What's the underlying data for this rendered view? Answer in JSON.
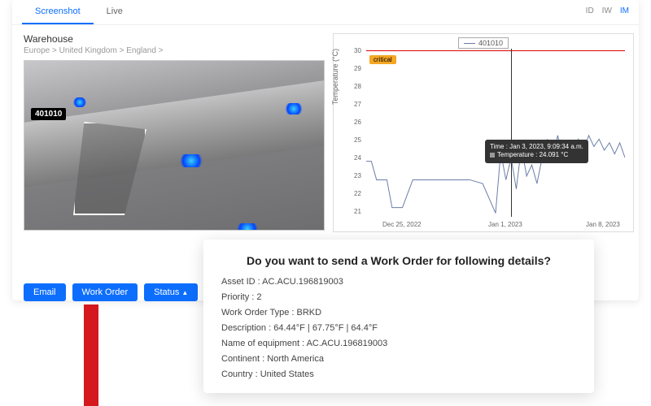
{
  "tabs": {
    "screenshot": "Screenshot",
    "live": "Live"
  },
  "viewModes": {
    "id": "ID",
    "iw": "IW",
    "im": "IM"
  },
  "location": {
    "title": "Warehouse",
    "crumb1": "Europe",
    "crumb2": "United Kingdom",
    "crumb3": "England",
    "sep": " > "
  },
  "asset_badge": "401010",
  "buttons": {
    "email": "Email",
    "work_order": "Work Order",
    "status": "Status"
  },
  "chart_data": {
    "type": "line",
    "legend": "401010",
    "ylabel": "Temperature (°C)",
    "ylim": [
      21,
      30
    ],
    "yticks": [
      21,
      22,
      23,
      24,
      25,
      26,
      27,
      28,
      29,
      30
    ],
    "xticks": [
      "Dec 25, 2022",
      "Jan 1, 2023",
      "Jan 8, 2023"
    ],
    "threshold_line": 30,
    "threshold_label": "critical",
    "tooltip": {
      "time_label": "Time : Jan 3, 2023, 9:09:34 a.m.",
      "temp_label": "Temperature : 24.091 °C"
    },
    "series": [
      {
        "name": "401010",
        "x": [
          0,
          2,
          4,
          6,
          8,
          10,
          14,
          18,
          22,
          28,
          34,
          40,
          45,
          50,
          52,
          54,
          56,
          58,
          60,
          62,
          64,
          66,
          68,
          70,
          72,
          74,
          76,
          78,
          80,
          82,
          84,
          86,
          88,
          90,
          92,
          94,
          96,
          98,
          100
        ],
        "y": [
          24,
          24,
          23,
          23,
          23,
          21.5,
          21.5,
          23,
          23,
          23,
          23,
          23,
          22.8,
          21.2,
          24.5,
          23,
          24.2,
          22.5,
          24.8,
          23.2,
          23.8,
          22.8,
          24.2,
          25.2,
          24,
          25.4,
          24.2,
          25,
          24.4,
          25.2,
          24.6,
          25.4,
          24.8,
          25.2,
          24.6,
          25,
          24.4,
          25,
          24.2
        ]
      }
    ]
  },
  "modal": {
    "title": "Do you want to send a Work Order for following details?",
    "rows": {
      "asset_id": {
        "label": "Asset ID",
        "value": "AC.ACU.196819003"
      },
      "priority": {
        "label": "Priority",
        "value": "2"
      },
      "wo_type": {
        "label": "Work Order Type",
        "value": "BRKD"
      },
      "desc": {
        "label": "Description",
        "value": "64.44°F | 67.75°F | 64.4°F"
      },
      "equip": {
        "label": "Name of equipment",
        "value": "AC.ACU.196819003"
      },
      "continent": {
        "label": "Continent",
        "value": "North America"
      },
      "country": {
        "label": "Country",
        "value": "United States"
      }
    }
  }
}
